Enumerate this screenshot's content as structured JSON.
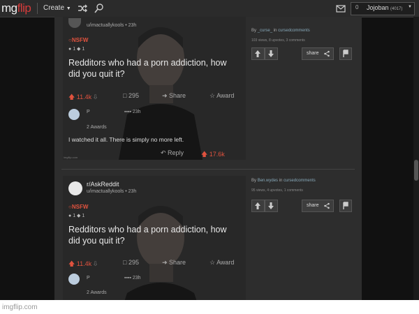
{
  "topbar": {
    "logo_text": "mg",
    "logo_flip": "flip",
    "create_label": "Create",
    "username": "Jojoban",
    "user_points": "(4017)"
  },
  "posts": [
    {
      "subreddit": "",
      "username": "u/imactuallykools • 23h",
      "nsfw": "NSFW",
      "awards": "1",
      "title_line1": "Redditors who had a porn addiction, how",
      "title_line2": "did you quit it?",
      "upvotes": "11.4k",
      "comments": "295",
      "share": "Share",
      "award": "Award",
      "reply_user": "P",
      "reply_time": "23h",
      "reply_awards": "2 Awards",
      "reply_text": "I watched it all. There is simply no more left.",
      "reply_label": "Reply",
      "reply_votes": "17.6k",
      "watermark": "imgflip.com",
      "meta_by": "By",
      "meta_author": "_curse_",
      "meta_in": "in",
      "meta_stream": "cursedcomments",
      "meta_stats": "103 views, 8 upvotes, 3 comments",
      "share_label": "share"
    },
    {
      "subreddit": "r/AskReddit",
      "username": "u/imactuallykools • 23h",
      "nsfw": "NSFW",
      "awards": "1",
      "title_line1": "Redditors who had a porn addiction, how",
      "title_line2": "did you quit it?",
      "upvotes": "11.4k",
      "comments": "295",
      "share": "Share",
      "award": "Award",
      "reply_user": "P",
      "reply_time": "23h",
      "reply_awards": "2 Awards",
      "meta_by": "By",
      "meta_author": "Ben.wydes",
      "meta_in": "in",
      "meta_stream": "cursedcomments",
      "meta_stats": "95 views, 4 upvotes, 1 comments",
      "share_label": "share"
    }
  ],
  "footer": {
    "watermark": "imgflip.com"
  }
}
